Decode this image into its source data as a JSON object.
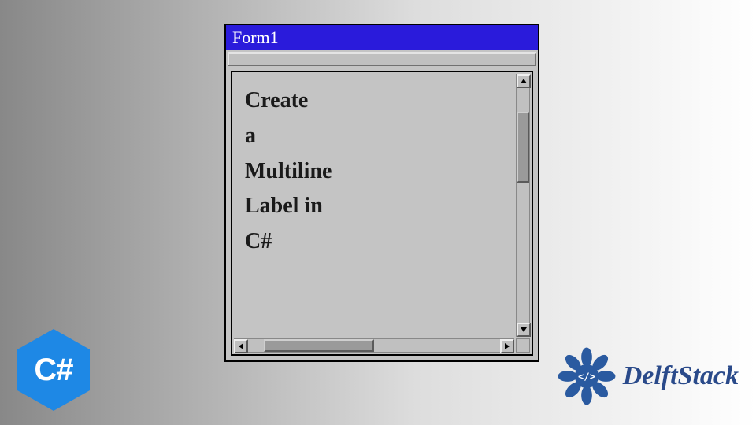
{
  "window": {
    "title": "Form1"
  },
  "label": {
    "text": "Create\na\nMultiline\nLabel in\nC#"
  },
  "badges": {
    "csharp": "C#",
    "delftstack": "DelftStack"
  }
}
